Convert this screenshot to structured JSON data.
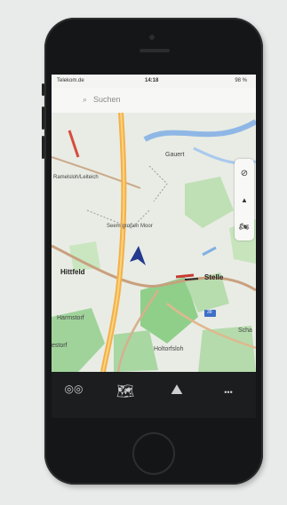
{
  "status": {
    "carrier": "Telekom.de",
    "time": "14:18",
    "battery": "98 %"
  },
  "search": {
    "placeholder": "Suchen",
    "icon": "search-icon"
  },
  "map": {
    "labels": {
      "gauert": "Gauert",
      "leuteweich": "Ramelsloh/Leiteich",
      "moor": "Seem großen Moor",
      "hittfeld": "Hittfeld",
      "stelle": "Stelle",
      "road39": "39",
      "harmstorf": "Harmstorf",
      "estorf": "estorf",
      "holtorfsloh": "Holtorfsloh",
      "scha": "Scha"
    }
  },
  "controls": [
    {
      "name": "compass-icon",
      "glyph": "⊘"
    },
    {
      "name": "navigate-arrow-icon",
      "glyph": "▲"
    },
    {
      "name": "motorcycle-icon",
      "glyph": "🏍"
    }
  ],
  "tabs": [
    {
      "name": "tab-ride-icon",
      "glyph": "◎◎"
    },
    {
      "name": "tab-map-icon",
      "glyph": "🗺"
    },
    {
      "name": "tab-routes-icon",
      "glyph": "⛰"
    },
    {
      "name": "tab-more-icon",
      "glyph": "•••"
    }
  ]
}
